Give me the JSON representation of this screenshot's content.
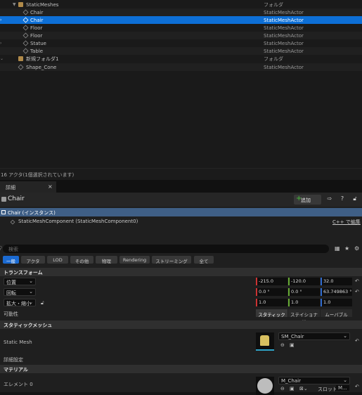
{
  "outliner": {
    "type_header": "",
    "rows": [
      {
        "name": "StaticMeshes",
        "type": "フォルダ"
      },
      {
        "name": "Chair",
        "type": "StaticMeshActor"
      },
      {
        "name": "Chair",
        "type": "StaticMeshActor"
      },
      {
        "name": "Floor",
        "type": "StaticMeshActor"
      },
      {
        "name": "Floor",
        "type": "StaticMeshActor"
      },
      {
        "name": "Statue",
        "type": "StaticMeshActor"
      },
      {
        "name": "Table",
        "type": "StaticMeshActor"
      },
      {
        "name": "新規フォルダ1",
        "type": "フォルダ"
      },
      {
        "name": "Shape_Cone",
        "type": "StaticMeshActor"
      }
    ],
    "status": "16 アクタ(1個選択されています)"
  },
  "tab": {
    "label": "詳細",
    "close": "×"
  },
  "details": {
    "title": "Chair",
    "add_label": "追加",
    "component_selected": "Chair (インスタンス)",
    "component": "StaticMeshComponent (StaticMeshComponent0)",
    "cpp_link": "C++ で編集",
    "search_placeholder": "検索",
    "filters": [
      "一般",
      "アクタ",
      "LOD",
      "その他",
      "物理",
      "Rendering",
      "ストリーミング",
      "全て"
    ],
    "active_filter": "一般"
  },
  "transform": {
    "section": "トランスフォーム",
    "location": {
      "label": "位置",
      "x": "-215.0",
      "y": "-120.0",
      "z": "32.0"
    },
    "rotation": {
      "label": "回転",
      "x": "0.0 °",
      "y": "0.0 °",
      "z": "63.749863 °"
    },
    "scale": {
      "label": "拡大・縮小",
      "x": "1.0",
      "y": "1.0",
      "z": "1.0"
    },
    "mobility": {
      "label": "可動性",
      "options": [
        "スタティック",
        "ステイショナリ",
        "ムーバブル"
      ],
      "selected": "スタティック"
    }
  },
  "static_mesh": {
    "section": "スタティックメッシュ",
    "label": "Static Mesh",
    "asset": "SM_Chair",
    "advanced": "詳細設定"
  },
  "materials": {
    "section": "マテリアル",
    "element_label": "エレメント 0",
    "asset": "M_Chair",
    "slot_label": "スロット",
    "slot_value": "M..."
  },
  "colors": {
    "selection": "#0d6fd6",
    "x_axis": "#c33",
    "y_axis": "#6a3",
    "z_axis": "#2f6bd0",
    "add_green": "#48c13c"
  }
}
